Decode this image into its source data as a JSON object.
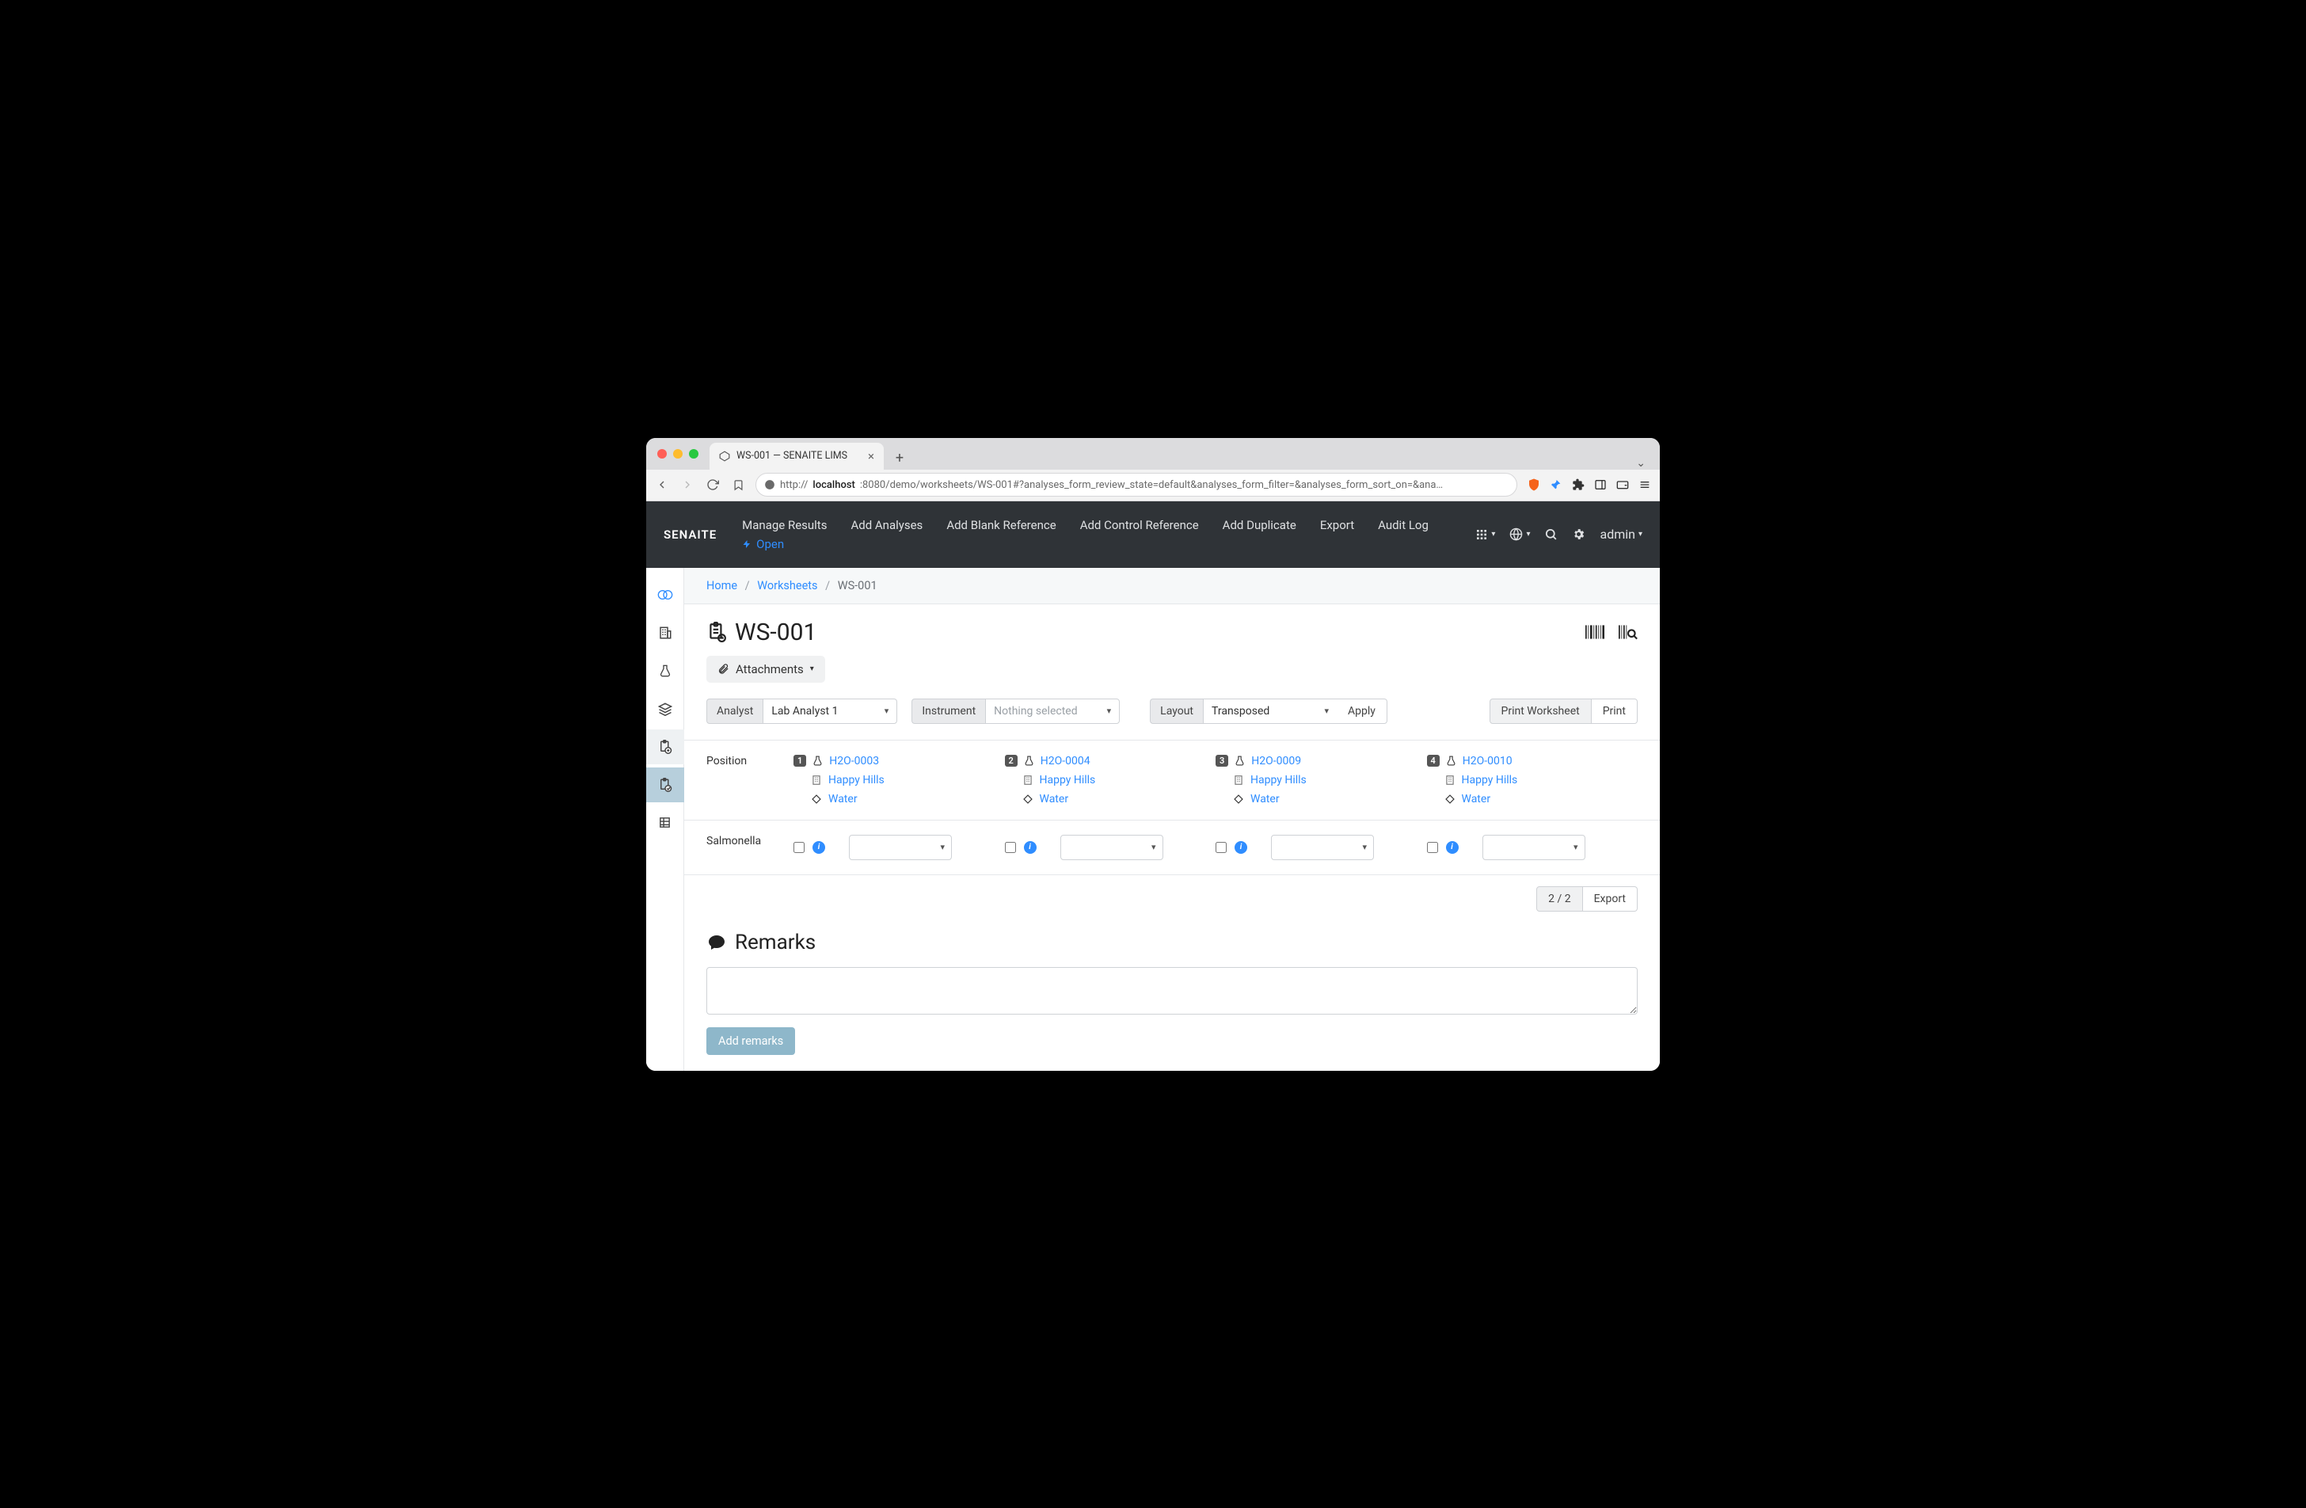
{
  "browser": {
    "tab_title": "WS-001 — SENAITE LIMS",
    "url_prefix": "http://",
    "url_host": "localhost",
    "url_port_path": ":8080/demo/worksheets/WS-001#?analyses_form_review_state=default&analyses_form_filter=&analyses_form_sort_on=&ana…"
  },
  "header": {
    "brand": "SENAITE",
    "nav": {
      "manage_results": "Manage Results",
      "add_analyses": "Add Analyses",
      "add_blank": "Add Blank Reference",
      "add_control": "Add Control Reference",
      "add_duplicate": "Add Duplicate",
      "export": "Export",
      "audit_log": "Audit Log",
      "open": "Open"
    },
    "user": "admin"
  },
  "breadcrumb": {
    "home": "Home",
    "worksheets": "Worksheets",
    "current": "WS-001"
  },
  "page": {
    "title": "WS-001",
    "attachments": "Attachments",
    "analyst_label": "Analyst",
    "analyst_value": "Lab Analyst 1",
    "instrument_label": "Instrument",
    "instrument_value": "Nothing selected",
    "layout_label": "Layout",
    "layout_value": "Transposed",
    "apply": "Apply",
    "print_ws": "Print Worksheet",
    "print": "Print"
  },
  "table": {
    "position_label": "Position",
    "row_label": "Salmonella",
    "cols": [
      {
        "n": "1",
        "sample": "H2O-0003",
        "client": "Happy Hills",
        "type": "Water"
      },
      {
        "n": "2",
        "sample": "H2O-0004",
        "client": "Happy Hills",
        "type": "Water"
      },
      {
        "n": "3",
        "sample": "H2O-0009",
        "client": "Happy Hills",
        "type": "Water"
      },
      {
        "n": "4",
        "sample": "H2O-0010",
        "client": "Happy Hills",
        "type": "Water"
      }
    ],
    "pager": "2 / 2",
    "export": "Export"
  },
  "remarks": {
    "heading": "Remarks",
    "add": "Add remarks"
  }
}
